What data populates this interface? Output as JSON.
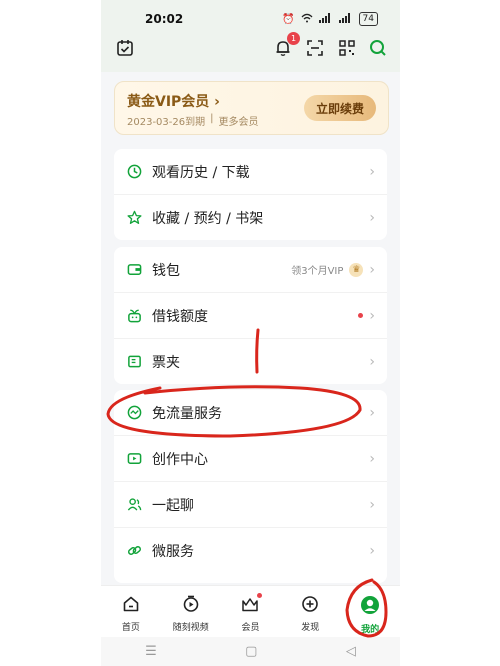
{
  "status_bar": {
    "time": "20:02",
    "battery": "74"
  },
  "header": {
    "notification_count": "1"
  },
  "vip": {
    "title": "黄金VIP会员",
    "expire": "2023-03-26到期",
    "separator": "|",
    "more": "更多会员",
    "renew_label": "立即续费"
  },
  "group1": [
    {
      "label": "观看历史 / 下载"
    },
    {
      "label": "收藏 / 预约 / 书架"
    }
  ],
  "group2": [
    {
      "label": "钱包",
      "extra": "领3个月VIP"
    },
    {
      "label": "借钱额度"
    },
    {
      "label": "票夹"
    }
  ],
  "group3": [
    {
      "label": "免流量服务"
    },
    {
      "label": "创作中心"
    },
    {
      "label": "一起聊"
    },
    {
      "label": "微服务"
    }
  ],
  "tabs": [
    {
      "label": "首页"
    },
    {
      "label": "随刻视频"
    },
    {
      "label": "会员"
    },
    {
      "label": "发现"
    },
    {
      "label": "我的"
    }
  ],
  "accent_color": "#12a33a",
  "annotation_color": "#d9261c"
}
